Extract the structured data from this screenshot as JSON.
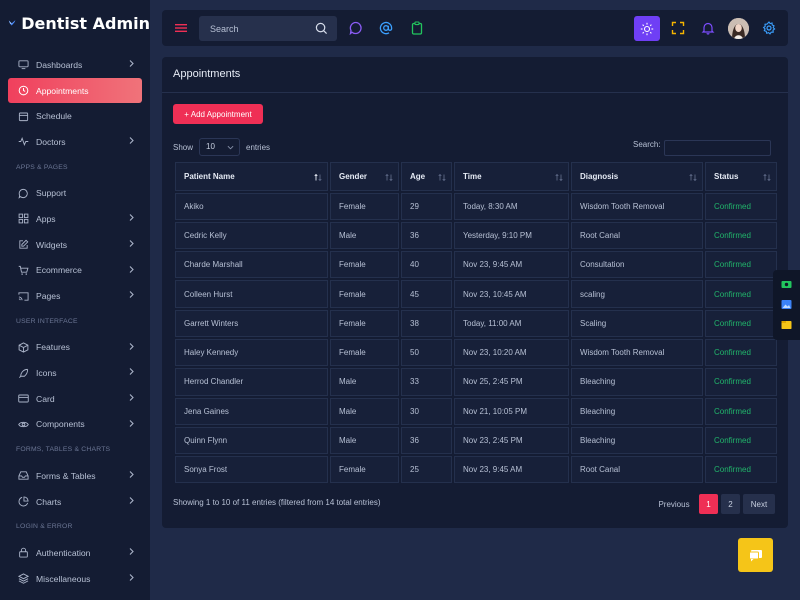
{
  "app": {
    "title": "Dentist Admin"
  },
  "sidebar": {
    "items": [
      {
        "type": "item",
        "label": "Dashboards",
        "icon": "monitor-icon",
        "chevron": true
      },
      {
        "type": "item",
        "label": "Appointments",
        "icon": "clock-icon",
        "chevron": false,
        "active": true
      },
      {
        "type": "item",
        "label": "Schedule",
        "icon": "calendar-icon",
        "chevron": false
      },
      {
        "type": "item",
        "label": "Doctors",
        "icon": "activity-icon",
        "chevron": true
      },
      {
        "type": "section",
        "label": "APPS & PAGES"
      },
      {
        "type": "item",
        "label": "Support",
        "icon": "chat-icon",
        "chevron": false
      },
      {
        "type": "item",
        "label": "Apps",
        "icon": "grid-icon",
        "chevron": true
      },
      {
        "type": "item",
        "label": "Widgets",
        "icon": "edit-icon",
        "chevron": true
      },
      {
        "type": "item",
        "label": "Ecommerce",
        "icon": "cart-icon",
        "chevron": true
      },
      {
        "type": "item",
        "label": "Pages",
        "icon": "cast-icon",
        "chevron": true
      },
      {
        "type": "section",
        "label": "USER INTERFACE"
      },
      {
        "type": "item",
        "label": "Features",
        "icon": "package-icon",
        "chevron": true
      },
      {
        "type": "item",
        "label": "Icons",
        "icon": "feather-icon",
        "chevron": true
      },
      {
        "type": "item",
        "label": "Card",
        "icon": "credit-card-icon",
        "chevron": true
      },
      {
        "type": "item",
        "label": "Components",
        "icon": "eye-icon",
        "chevron": true
      },
      {
        "type": "section",
        "label": "FORMS, TABLES & CHARTS"
      },
      {
        "type": "item",
        "label": "Forms & Tables",
        "icon": "inbox-icon",
        "chevron": true
      },
      {
        "type": "item",
        "label": "Charts",
        "icon": "pie-chart-icon",
        "chevron": true
      },
      {
        "type": "section",
        "label": "LOGIN & ERROR"
      },
      {
        "type": "item",
        "label": "Authentication",
        "icon": "lock-icon",
        "chevron": true
      },
      {
        "type": "item",
        "label": "Miscellaneous",
        "icon": "layers-icon",
        "chevron": true
      }
    ]
  },
  "header": {
    "search_placeholder": "Search",
    "accent_color": "#6f3ff5"
  },
  "card": {
    "title": "Appointments",
    "add_button": "+ Add Appointment",
    "show_label": "Show",
    "entries_label": "entries",
    "page_size": "10",
    "search_label": "Search:"
  },
  "table": {
    "columns": [
      "Patient Name",
      "Gender",
      "Age",
      "Time",
      "Diagnosis",
      "Status"
    ],
    "rows": [
      [
        "Akiko",
        "Female",
        "29",
        "Today, 8:30 AM",
        "Wisdom Tooth Removal",
        "Confirmed"
      ],
      [
        "Cedric Kelly",
        "Male",
        "36",
        "Yesterday, 9:10 PM",
        "Root Canal",
        "Confirmed"
      ],
      [
        "Charde Marshall",
        "Female",
        "40",
        "Nov 23, 9:45 AM",
        "Consultation",
        "Confirmed"
      ],
      [
        "Colleen Hurst",
        "Female",
        "45",
        "Nov 23, 10:45 AM",
        "scaling",
        "Confirmed"
      ],
      [
        "Garrett Winters",
        "Female",
        "38",
        "Today, 11:00 AM",
        "Scaling",
        "Confirmed"
      ],
      [
        "Haley Kennedy",
        "Female",
        "50",
        "Nov 23, 10:20 AM",
        "Wisdom Tooth Removal",
        "Confirmed"
      ],
      [
        "Herrod Chandler",
        "Male",
        "33",
        "Nov 25, 2:45 PM",
        "Bleaching",
        "Confirmed"
      ],
      [
        "Jena Gaines",
        "Male",
        "30",
        "Nov 21, 10:05 PM",
        "Bleaching",
        "Confirmed"
      ],
      [
        "Quinn Flynn",
        "Male",
        "36",
        "Nov 23, 2:45 PM",
        "Bleaching",
        "Confirmed"
      ],
      [
        "Sonya Frost",
        "Female",
        "25",
        "Nov 23, 9:45 AM",
        "Root Canal",
        "Confirmed"
      ]
    ],
    "status_color": "#21b56b"
  },
  "footer": {
    "info": "Showing 1 to 10 of 11 entries (filtered from 14 total entries)",
    "previous": "Previous",
    "pages": [
      "1",
      "2"
    ],
    "next": "Next",
    "active_page": "1"
  }
}
